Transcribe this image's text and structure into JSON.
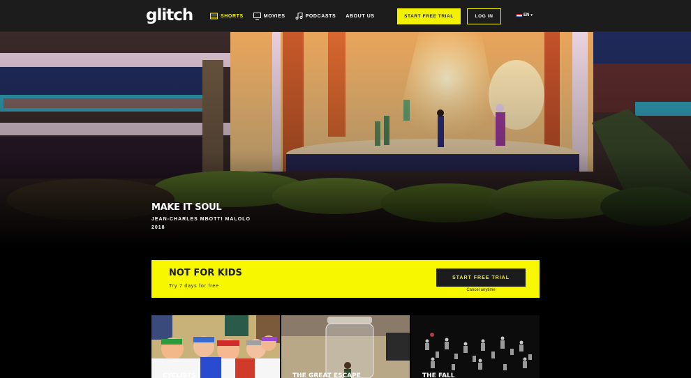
{
  "header": {
    "logo": "glitch",
    "nav": [
      {
        "label": "SHORTS",
        "icon": "film-icon",
        "active": true
      },
      {
        "label": "MOVIES",
        "icon": "tv-icon",
        "active": false
      },
      {
        "label": "PODCASTS",
        "icon": "music-note-icon",
        "active": false
      },
      {
        "label": "ABOUT US",
        "icon": "",
        "active": false
      }
    ],
    "trial_button": "START FREE TRIAL",
    "login_button": "LOG IN",
    "language": "EN"
  },
  "hero": {
    "title": "MAKE IT SOUL",
    "director": "JEAN-CHARLES MBOTTI MALOLO",
    "year": "2018"
  },
  "banner": {
    "title": "NOT FOR KIDS",
    "subtitle": "Try 7 days for free",
    "button": "START FREE TRIAL",
    "note": "Cancel anytime"
  },
  "cards": [
    {
      "title": "CYCLISTS"
    },
    {
      "title": "THE GREAT ESCAPE"
    },
    {
      "title": "THE FALL"
    }
  ],
  "colors": {
    "accent": "#f2f200",
    "header_bg": "#1c1c1c",
    "page_bg": "#000000"
  }
}
